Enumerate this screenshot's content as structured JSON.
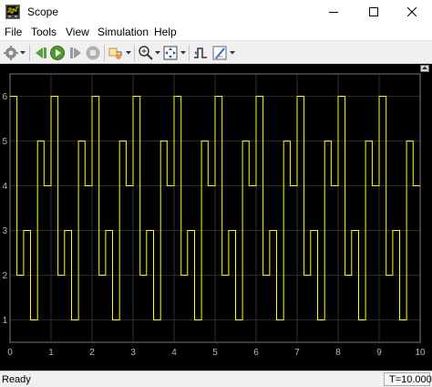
{
  "window": {
    "title": "Scope",
    "icon": "scope-app-icon",
    "controls": [
      "minimize-icon",
      "maximize-icon",
      "close-icon"
    ]
  },
  "menu": [
    "File",
    "Tools",
    "View",
    "Simulation",
    "Help"
  ],
  "toolbar": [
    "settings-gear-icon",
    "dropdown-arrow-icon",
    "step-back-icon",
    "run-icon",
    "step-forward-icon",
    "stop-icon",
    "highlight-simulink-block-icon",
    "dropdown-arrow-icon",
    "zoom-in-icon",
    "dropdown-arrow-icon",
    "autoscale-axes-icon",
    "dropdown-arrow-icon",
    "signal-trigger-icon",
    "cursor-measurements-icon",
    "dropdown-arrow-icon"
  ],
  "status": {
    "text": "Ready",
    "time": "T=10.000"
  },
  "colors": {
    "plot_background": "#000000",
    "axes_background": "#000000",
    "grid": "#505050",
    "axis_text": "#b8b8b8",
    "signal": "#ffff00"
  },
  "chart_data": {
    "type": "line",
    "step": true,
    "xlim": [
      0,
      10
    ],
    "ylim": [
      0.5,
      6.5
    ],
    "x_ticks": [
      "0",
      "1",
      "2",
      "3",
      "4",
      "5",
      "6",
      "7",
      "8",
      "9",
      "10"
    ],
    "y_ticks": [
      "1",
      "2",
      "3",
      "4",
      "5",
      "6"
    ],
    "grid": true,
    "x_ticks_values": [
      0,
      1,
      2,
      3,
      4,
      5,
      6,
      7,
      8,
      9,
      10
    ],
    "y_ticks_values": [
      1,
      2,
      3,
      4,
      5,
      6
    ],
    "sequence": [
      6,
      2,
      3,
      1,
      5,
      4,
      6,
      2,
      3,
      1,
      5,
      4
    ],
    "dwell": 0.1667,
    "x": [
      0,
      0.17,
      0.33,
      0.5,
      0.67,
      0.83,
      1.0,
      1.17,
      1.33,
      1.5,
      1.67,
      1.83,
      2.0,
      2.17,
      2.33,
      2.5,
      2.67,
      2.83,
      3.0,
      3.17,
      3.33,
      3.5,
      3.67,
      3.83,
      4.0,
      4.17,
      4.33,
      4.5,
      4.67,
      4.83,
      5.0,
      5.17,
      5.33,
      5.5,
      5.67,
      5.83,
      6.0,
      6.17,
      6.33,
      6.5,
      6.67,
      6.83,
      7.0,
      7.17,
      7.33,
      7.5,
      7.67,
      7.83,
      8.0,
      8.17,
      8.33,
      8.5,
      8.67,
      8.83,
      9.0,
      9.17,
      9.33,
      9.5,
      9.67,
      9.83
    ],
    "y": [
      6,
      2,
      3,
      1,
      5,
      4,
      6,
      2,
      3,
      1,
      5,
      4,
      6,
      2,
      3,
      1,
      5,
      4,
      6,
      2,
      3,
      1,
      5,
      4,
      6,
      2,
      3,
      1,
      5,
      4,
      6,
      2,
      3,
      1,
      5,
      4,
      6,
      2,
      3,
      1,
      5,
      4,
      6,
      2,
      3,
      1,
      5,
      4,
      6,
      2,
      3,
      1,
      5,
      4,
      6,
      2,
      3,
      1,
      5,
      4
    ]
  }
}
